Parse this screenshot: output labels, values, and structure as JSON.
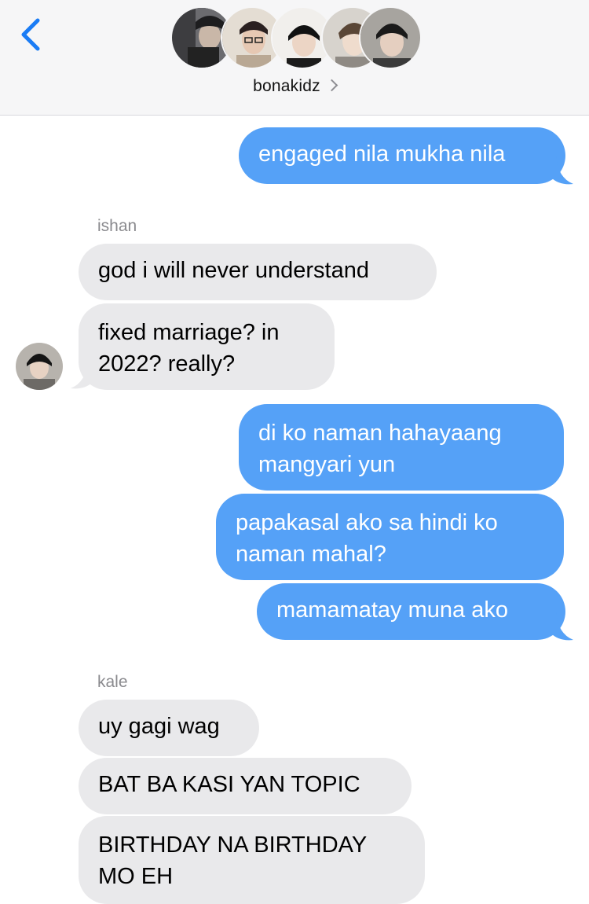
{
  "header": {
    "group_name": "bonakidz",
    "back_icon": "chevron-left-icon"
  },
  "colors": {
    "outgoing_bubble": "#55a1f7",
    "incoming_bubble": "#e9e9eb",
    "accent": "#1a7cf5"
  },
  "messages": [
    {
      "direction": "out",
      "text": "engaged nila mukha nila"
    },
    {
      "direction": "in",
      "sender": "ishan"
    },
    {
      "direction": "in",
      "text": "god i will never understand"
    },
    {
      "direction": "in",
      "line1": "fixed marriage? in",
      "line2": "2022? really?"
    },
    {
      "direction": "out",
      "line1": "di ko naman hahayaang",
      "line2": "mangyari yun"
    },
    {
      "direction": "out",
      "line1": "papakasal ako sa hindi ko",
      "line2": "naman mahal?"
    },
    {
      "direction": "out",
      "text": "mamamatay muna ako"
    },
    {
      "direction": "in",
      "sender": "kale"
    },
    {
      "direction": "in",
      "text": "uy gagi wag"
    },
    {
      "direction": "in",
      "text": "BAT BA KASI YAN TOPIC"
    },
    {
      "direction": "in",
      "line1": "BIRTHDAY NA BIRTHDAY",
      "line2": "MO EH"
    }
  ]
}
